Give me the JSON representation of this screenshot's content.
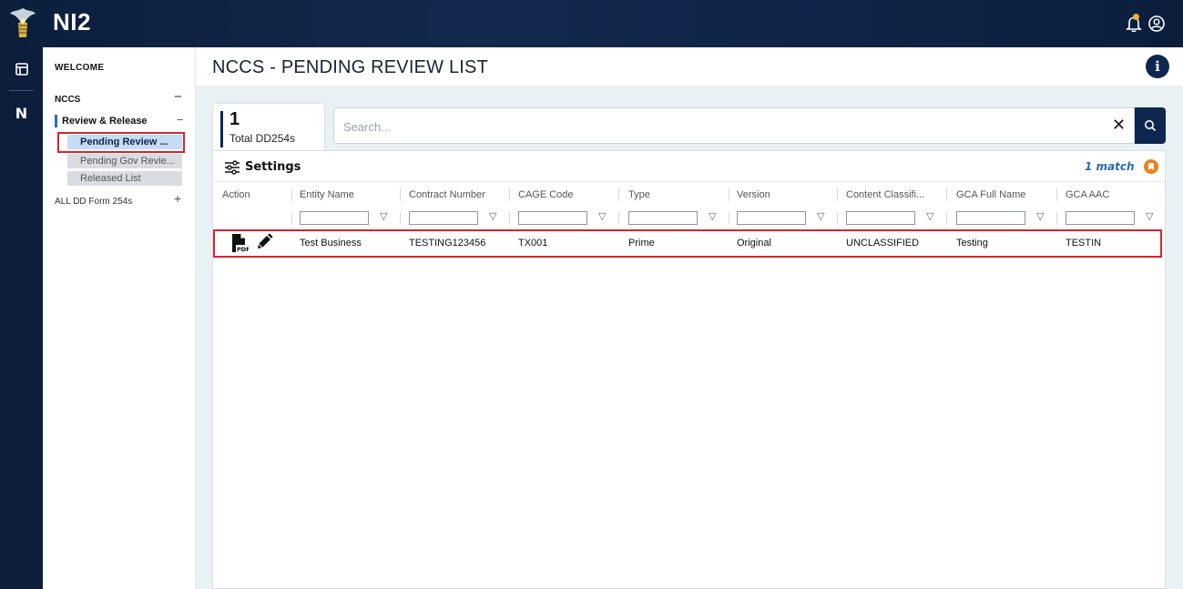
{
  "app": {
    "title": "NI2",
    "brand_color": "#0c1e3c",
    "accent": "#2b6cb0"
  },
  "topbar": {
    "icons": [
      "notification-bell-icon",
      "user-account-icon"
    ]
  },
  "rail": {
    "items": [
      {
        "icon": "dashboard-icon"
      },
      {
        "label": "N"
      }
    ]
  },
  "sidebar": {
    "welcome": "WELCOME",
    "nccs": {
      "label": "NCCS",
      "toggle": "−"
    },
    "review_release": {
      "label": "Review & Release",
      "toggle": "−"
    },
    "sub_items": [
      {
        "label": "Pending Review ...",
        "state": "active"
      },
      {
        "label": "Pending Gov Revie...",
        "state": "normal"
      },
      {
        "label": "Released List",
        "state": "normal"
      }
    ],
    "all_forms": {
      "label": "ALL DD Form 254s",
      "toggle": "+"
    }
  },
  "page": {
    "title": "NCCS - PENDING REVIEW LIST"
  },
  "summary": {
    "count": "1",
    "label": "Total DD254s"
  },
  "search": {
    "placeholder": "Search...",
    "value": "",
    "clear": "✕"
  },
  "grid": {
    "settings_label": "Settings",
    "match_text": "1 match",
    "columns": [
      "Action",
      "Entity Name",
      "Contract Number",
      "CAGE Code",
      "Type",
      "Version",
      "Content Classifi...",
      "GCA Full Name",
      "GCA AAC"
    ],
    "filter_icon": "▽",
    "rows": [
      {
        "actions": [
          "pdf-icon",
          "edit-pencil-icon"
        ],
        "entity_name": "Test Business",
        "contract_number": "TESTING123456",
        "cage_code": "TX001",
        "type": "Prime",
        "version": "Original",
        "content_classification": "UNCLASSIFIED",
        "gca_full_name": "Testing",
        "gca_aac": "TESTIN"
      }
    ]
  }
}
